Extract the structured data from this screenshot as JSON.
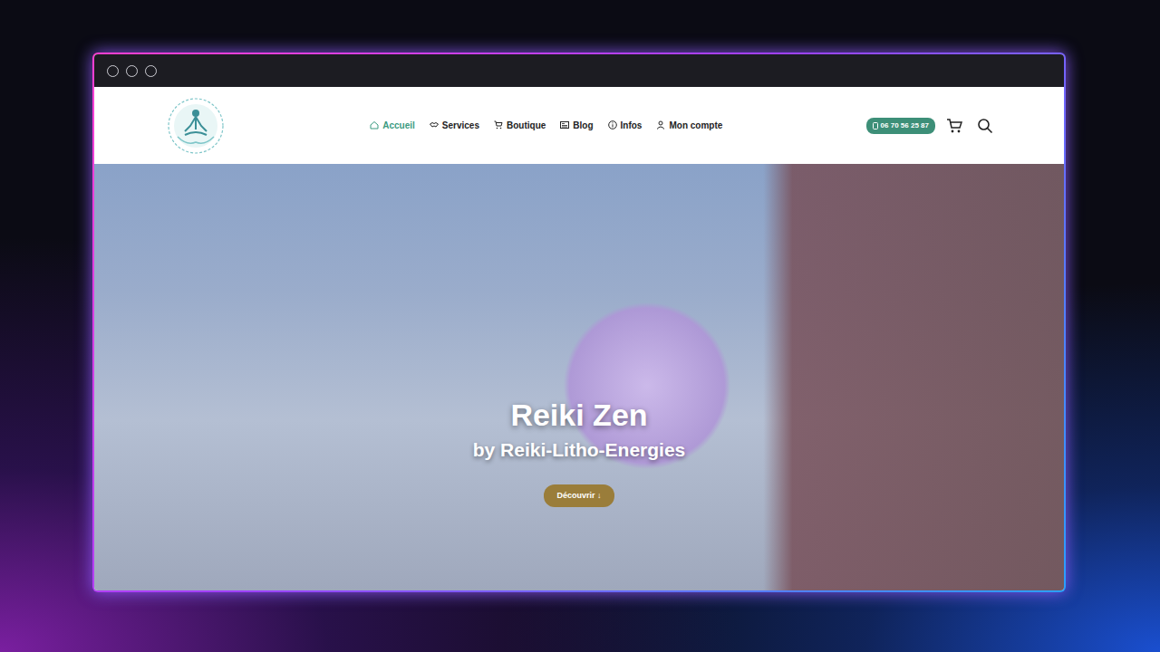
{
  "nav": {
    "items": [
      {
        "label": "Accueil",
        "selected": true
      },
      {
        "label": "Services",
        "selected": false
      },
      {
        "label": "Boutique",
        "selected": false
      },
      {
        "label": "Blog",
        "selected": false
      },
      {
        "label": "Infos",
        "selected": false
      },
      {
        "label": "Mon compte",
        "selected": false
      }
    ]
  },
  "phone": "06 70 56 25 87",
  "hero": {
    "title": "Reiki Zen",
    "subtitle": "by Reiki-Litho-Energies",
    "button": "Découvrir ↓"
  }
}
